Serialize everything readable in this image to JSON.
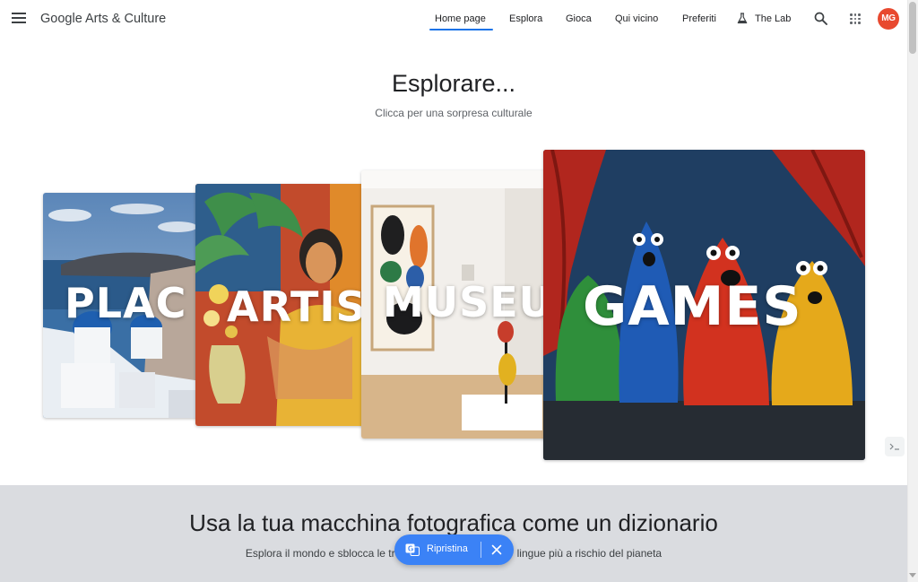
{
  "header": {
    "logo_text": "Google Arts & Culture",
    "nav": [
      {
        "label": "Home page",
        "active": true
      },
      {
        "label": "Esplora"
      },
      {
        "label": "Gioca"
      },
      {
        "label": "Qui vicino"
      },
      {
        "label": "Preferiti"
      },
      {
        "label": "The Lab",
        "icon": "flask-icon"
      }
    ],
    "avatar_initials": "MG",
    "icons": [
      "menu-icon",
      "search-icon",
      "apps-grid-icon"
    ]
  },
  "hero": {
    "title": "Esplorare...",
    "subtitle": "Clicca per una sorpresa culturale",
    "cards": [
      {
        "label": "PLAC"
      },
      {
        "label": "ARTIS"
      },
      {
        "label": "MUSEU"
      },
      {
        "label": "GAMES"
      }
    ]
  },
  "band": {
    "title": "Usa la tua macchina fotografica come un dizionario",
    "subtitle_left": "Esplora il mondo e sblocca le tr",
    "subtitle_right": "lingue più a rischio del pianeta"
  },
  "translate_pill": {
    "label": "Ripristina",
    "icons": [
      "translate-icon",
      "close-icon"
    ]
  },
  "colors": {
    "accent": "#1a73e8",
    "avatar": "#e8492f",
    "pill": "#3b82f6",
    "band": "#dadce0"
  }
}
